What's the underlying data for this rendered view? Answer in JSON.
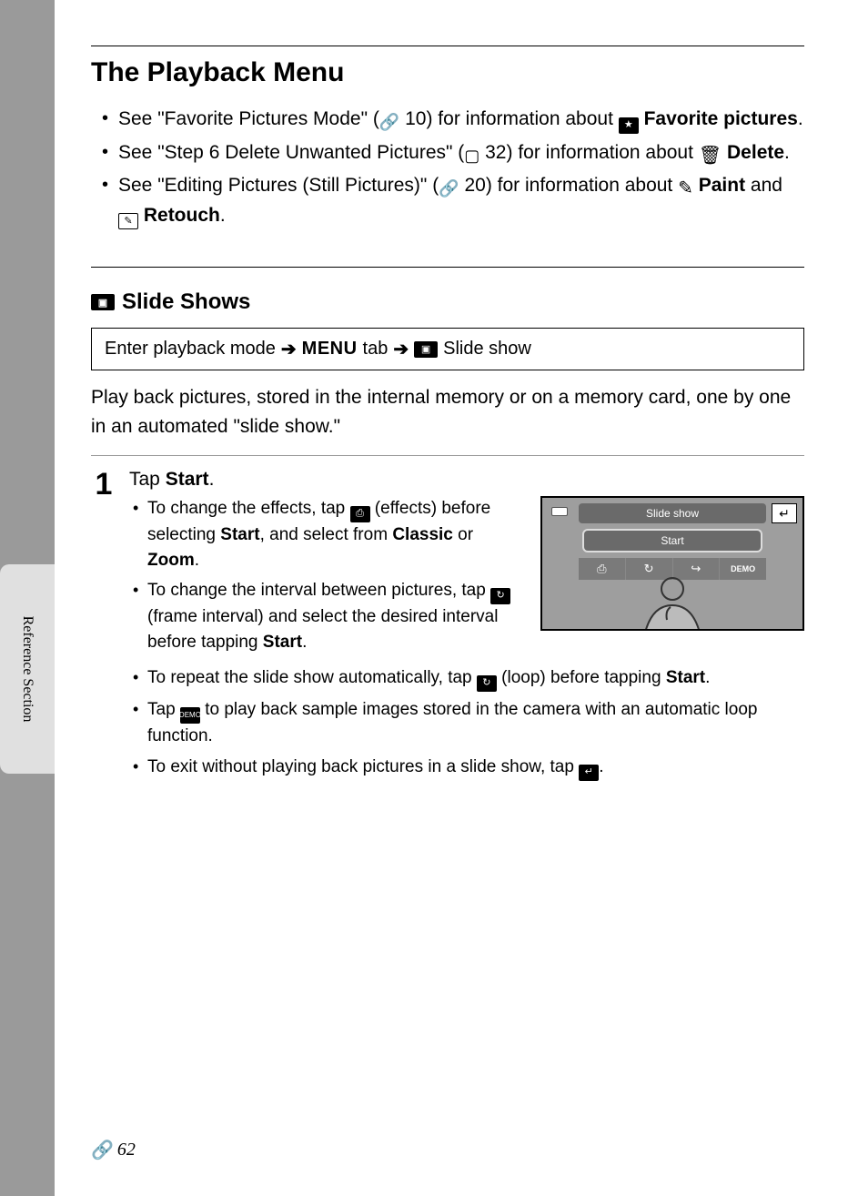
{
  "sidebar": {
    "label": "Reference Section"
  },
  "title": "The Playback Menu",
  "top_bullets": [
    {
      "pre": "See \"Favorite Pictures Mode\" (",
      "ref_icon": "ref",
      "ref_num": " 10",
      "mid": ") for information about ",
      "feat_icon": "star",
      "feat_bold": "Favorite pictures",
      "post": "."
    },
    {
      "pre": "See \"Step 6 Delete Unwanted Pictures\" (",
      "ref_icon": "book",
      "ref_num": " 32",
      "mid": ") for information about ",
      "feat_icon": "trash",
      "feat_bold": "Delete",
      "post": "."
    },
    {
      "pre": "See \"Editing Pictures (Still Pictures)\" (",
      "ref_icon": "ref",
      "ref_num": " 20",
      "mid": ") for information about ",
      "feat_icon": "pencil",
      "feat_bold": "Paint",
      "post2_pre": " and ",
      "feat2_icon": "retouch",
      "feat2_bold": "Retouch",
      "post": "."
    }
  ],
  "subhead": {
    "icon": "slideshow",
    "text": "Slide Shows"
  },
  "nav_path": {
    "p1": "Enter playback mode",
    "p2": "MENU",
    "p2_suffix": " tab",
    "p3_icon": "slideshow",
    "p3": " Slide show"
  },
  "intro": "Play back pictures, stored in the internal memory or on a memory card, one by one in an automated \"slide show.\"",
  "step": {
    "num": "1",
    "title_pre": "Tap ",
    "title_bold": "Start",
    "title_post": ".",
    "bullets_left": [
      {
        "t1": "To change the effects, tap ",
        "icon": "effects",
        "t2": " (effects) before selecting ",
        "b1": "Start",
        "t3": ", and select from ",
        "b2": "Classic",
        "t4": " or ",
        "b3": "Zoom",
        "t5": "."
      },
      {
        "t1": "To change the interval between pictures, tap ",
        "icon": "interval",
        "t2": " (frame interval) and select the desired interval before tapping ",
        "b1": "Start",
        "t3": "."
      }
    ],
    "bullets_full": [
      {
        "t1": "To repeat the slide show automatically, tap ",
        "icon": "loop",
        "t2": " (loop) before tapping ",
        "b1": "Start",
        "t3": "."
      },
      {
        "t1": "Tap ",
        "icon": "demo",
        "t2": " to play back sample images stored in the camera with an automatic loop function."
      },
      {
        "t1": "To exit without playing back pictures in a slide show, tap ",
        "icon": "back",
        "t2": "."
      }
    ]
  },
  "screen": {
    "title": "Slide show",
    "start": "Start",
    "icons": {
      "effects": "⎙",
      "interval": "↻",
      "loop": "↪",
      "demo": "DEMO"
    }
  },
  "page_num": "62"
}
